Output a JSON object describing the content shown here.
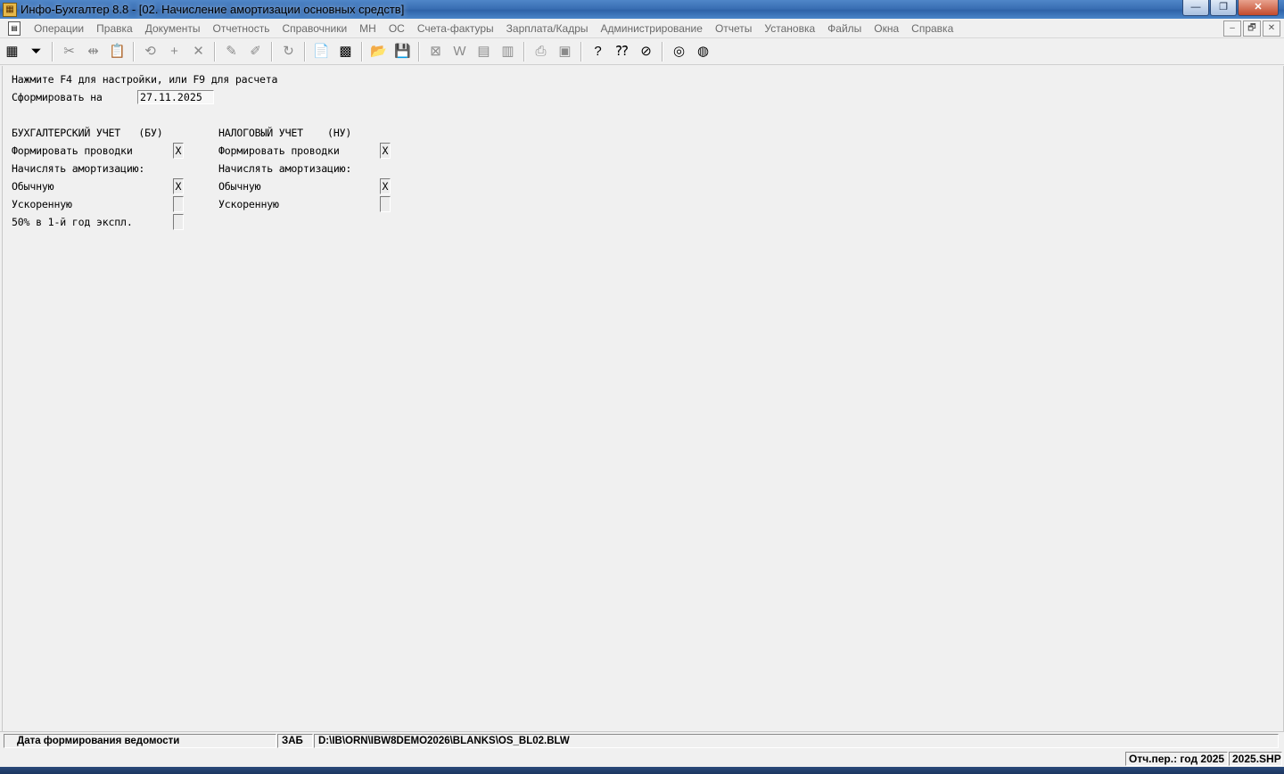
{
  "window": {
    "title": "Инфо-Бухгалтер 8.8 - [02.  Начисление амортизации основных средств]",
    "controls": [
      "—",
      "❐",
      "✕"
    ]
  },
  "menu": {
    "items": [
      "Операции",
      "Правка",
      "Документы",
      "Отчетность",
      "Справочники",
      "МН",
      "ОС",
      "Счета-фактуры",
      "Зарплата/Кадры",
      "Администрирование",
      "Отчеты",
      "Установка",
      "Файлы",
      "Окна",
      "Справка"
    ],
    "mdi_controls": [
      "–",
      "🗗",
      "✕"
    ]
  },
  "toolbar": {
    "icons": [
      {
        "name": "table-view-icon",
        "glyph": "▦",
        "active": true
      },
      {
        "name": "filter-icon",
        "glyph": "⏷",
        "active": true
      },
      {
        "sep": true
      },
      {
        "name": "cut-icon",
        "glyph": "✂",
        "active": false
      },
      {
        "name": "split-icon",
        "glyph": "⇹",
        "active": false
      },
      {
        "name": "paste-icon",
        "glyph": "📋",
        "active": false
      },
      {
        "sep": true
      },
      {
        "name": "rotate-180-icon",
        "glyph": "⟲",
        "active": false
      },
      {
        "name": "add-icon",
        "glyph": "+",
        "active": false
      },
      {
        "name": "delete-icon",
        "glyph": "✕",
        "active": false
      },
      {
        "sep": true
      },
      {
        "name": "wand-icon",
        "glyph": "✎",
        "active": false
      },
      {
        "name": "wand-calc-icon",
        "glyph": "✐",
        "active": false
      },
      {
        "sep": true
      },
      {
        "name": "refresh-icon",
        "glyph": "↻",
        "active": false
      },
      {
        "sep": true
      },
      {
        "name": "pdf-export-icon",
        "glyph": "📄",
        "active": true
      },
      {
        "name": "calculator-icon",
        "glyph": "▩",
        "active": true
      },
      {
        "sep": true
      },
      {
        "name": "open-folder-icon",
        "glyph": "📂",
        "active": true
      },
      {
        "name": "save-icon",
        "glyph": "💾",
        "active": false
      },
      {
        "sep": true
      },
      {
        "name": "excel-export-icon",
        "glyph": "⊠",
        "active": false
      },
      {
        "name": "word-export-icon",
        "glyph": "W",
        "active": false
      },
      {
        "name": "doc-icon",
        "glyph": "▤",
        "active": false
      },
      {
        "name": "doc-alt-icon",
        "glyph": "▥",
        "active": false
      },
      {
        "sep": true
      },
      {
        "name": "print-icon",
        "glyph": "⎙",
        "active": false
      },
      {
        "name": "print-preview-icon",
        "glyph": "▣",
        "active": false
      },
      {
        "sep": true
      },
      {
        "name": "help-icon",
        "glyph": "?",
        "active": true
      },
      {
        "name": "context-help-icon",
        "glyph": "⁇",
        "active": true
      },
      {
        "name": "compass-icon",
        "glyph": "⊘",
        "active": true
      },
      {
        "sep": true
      },
      {
        "name": "lifebuoy-icon",
        "glyph": "◎",
        "active": true
      },
      {
        "name": "globe-icon",
        "glyph": "◍",
        "active": true
      }
    ]
  },
  "form": {
    "hint": "Нажмите F4 для настройки, или F9 для расчета",
    "date_label": "Сформировать на",
    "date_value": "27.11.2025",
    "bu": {
      "header": "БУХГАЛТЕРСКИЙ УЧЕТ   (БУ)",
      "post_label": "Формировать проводки",
      "post_value": "X",
      "accrue_label": "Начислять амортизацию:",
      "normal_label": "Обычную",
      "normal_value": "X",
      "accel_label": "Ускоренную",
      "accel_value": "",
      "first_year_label": "50% в 1-й год экспл.",
      "first_year_value": ""
    },
    "nu": {
      "header": "НАЛОГОВЫЙ УЧЕТ    (НУ)",
      "post_label": "Формировать проводки",
      "post_value": "X",
      "accrue_label": "Начислять амортизацию:",
      "normal_label": "Обычную",
      "normal_value": "X",
      "accel_label": "Ускоренную",
      "accel_value": ""
    }
  },
  "status": {
    "description": "Дата формирования ведомости",
    "mode": "ЗАБ",
    "path": "D:\\IB\\ORN\\IBW8DEMO2026\\BLANKS\\OS_BL02.BLW",
    "period": "Отч.пер.: год 2025",
    "file": "2025.SHP"
  }
}
